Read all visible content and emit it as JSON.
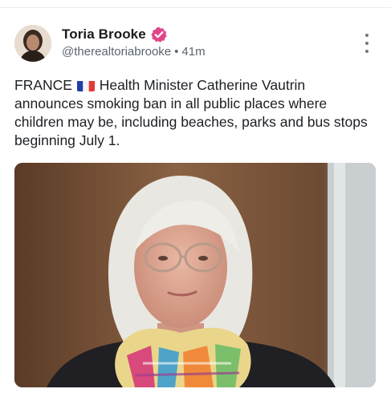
{
  "post": {
    "author": {
      "display_name": "Toria Brooke",
      "handle": "@therealtoriabrooke",
      "separator": "•",
      "timestamp": "41m",
      "verified": true
    },
    "text_before_flag": "FRANCE",
    "flag_icon": "france-flag-icon",
    "text_after_flag": "Health Minister Catherine Vautrin announces smoking ban in all public places where children may be, including beaches, parks and bus stops beginning July 1.",
    "media": {
      "type": "photo",
      "subject": "woman-portrait"
    }
  },
  "colors": {
    "verified_badge": "#e0458b",
    "more_dots": "#6e7681",
    "handle_gray": "#5b6470"
  }
}
